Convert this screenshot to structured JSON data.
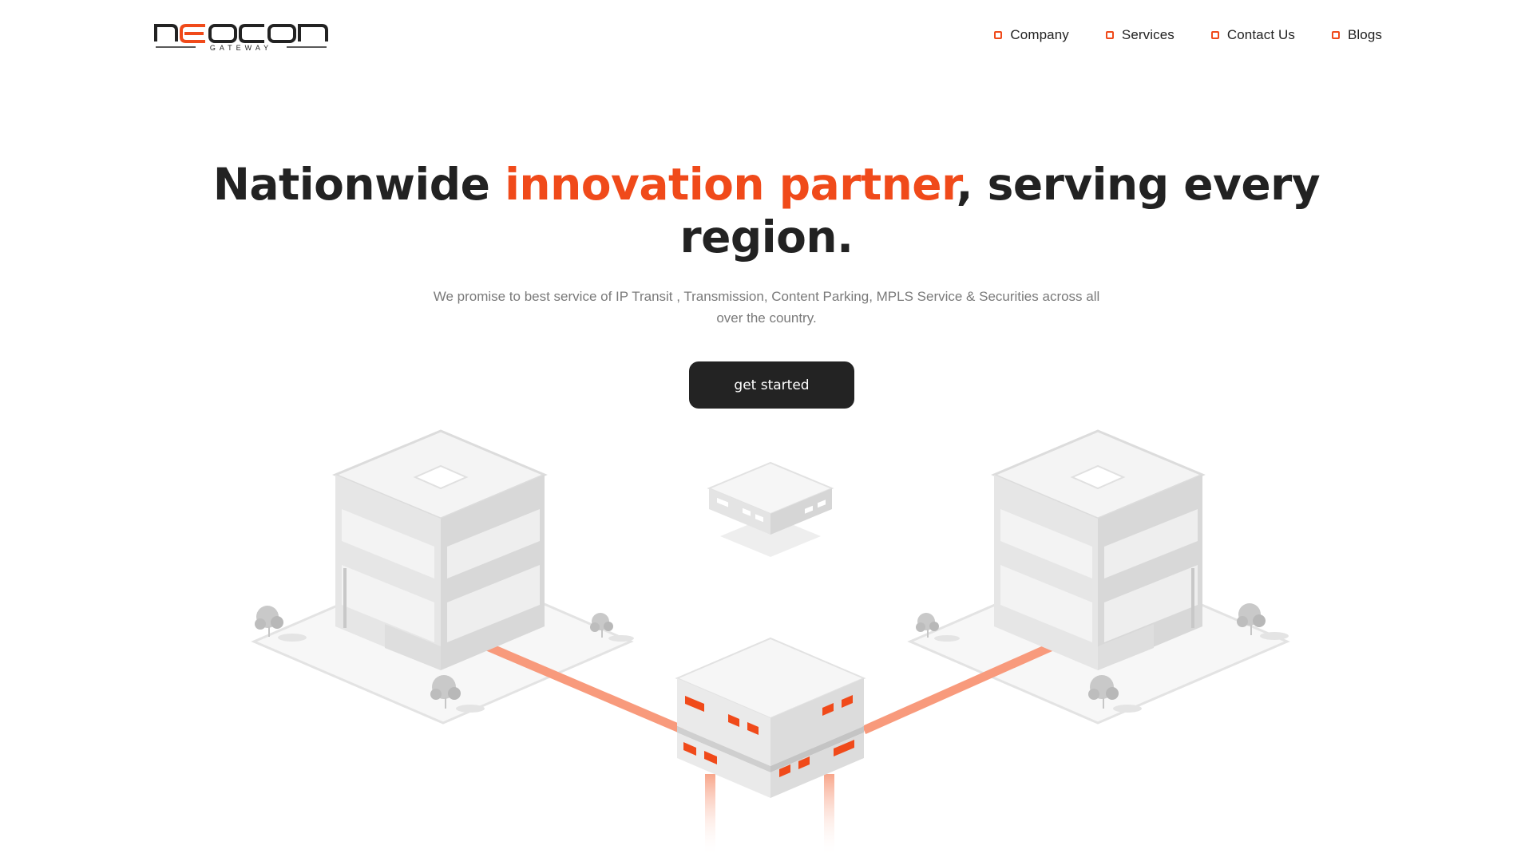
{
  "brand": {
    "name": "NEOCON",
    "tagline": "GATEWAY",
    "accent": "#f04a1a",
    "dark": "#232323"
  },
  "nav": {
    "items": [
      {
        "label": "Company"
      },
      {
        "label": "Services"
      },
      {
        "label": "Contact Us"
      },
      {
        "label": "Blogs"
      }
    ]
  },
  "hero": {
    "headline_part1": "Nationwide ",
    "headline_accent": "innovation partner",
    "headline_part2": ", serving every",
    "headline_line2": "region.",
    "subtitle_line1": "We promise to best service of IP Transit , Transmission, Content Parking, MPLS Service & Securities across all",
    "subtitle_line2": "over the country.",
    "cta_label": "get started"
  }
}
